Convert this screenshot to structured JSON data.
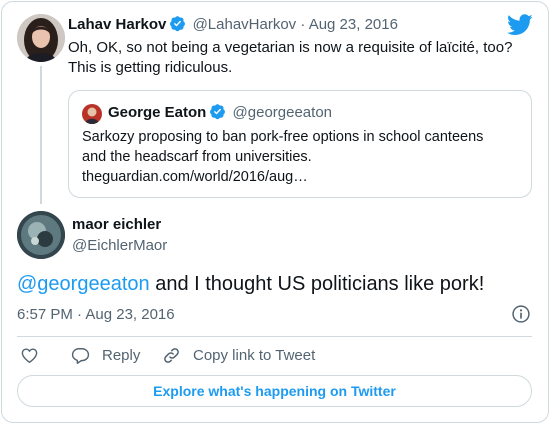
{
  "colors": {
    "accent": "#1d9bf0",
    "muted": "#536471",
    "border": "#cfd9de",
    "text": "#0f1419"
  },
  "parent_tweet": {
    "author_name": "Lahav Harkov",
    "author_handle": "@LahavHarkov",
    "separator": "·",
    "date": "Aug 23, 2016",
    "text_line1": "Oh, OK, so not being a vegetarian is now a requisite of laïcité, too?",
    "text_line2": "This is getting ridiculous.",
    "quoted": {
      "author_name": "George Eaton",
      "author_handle": "@georgeeaton",
      "text_line1": "Sarkozy proposing to ban pork-free options in school canteens",
      "text_line2": "and the headscarf from universities.",
      "link": "theguardian.com/world/2016/aug…"
    }
  },
  "main_tweet": {
    "author_name": "maor eichler",
    "author_handle": "@EichlerMaor",
    "mention": "@georgeeaton",
    "text": " and I thought US politicians like pork!",
    "timestamp": "6:57 PM · Aug 23, 2016"
  },
  "actions": {
    "reply_label": "Reply",
    "copy_label": "Copy link to Tweet"
  },
  "explore_label": "Explore what's happening on Twitter",
  "icons": [
    "twitter-bird-icon",
    "verified-icon",
    "info-icon",
    "heart-icon",
    "reply-icon",
    "link-icon"
  ]
}
